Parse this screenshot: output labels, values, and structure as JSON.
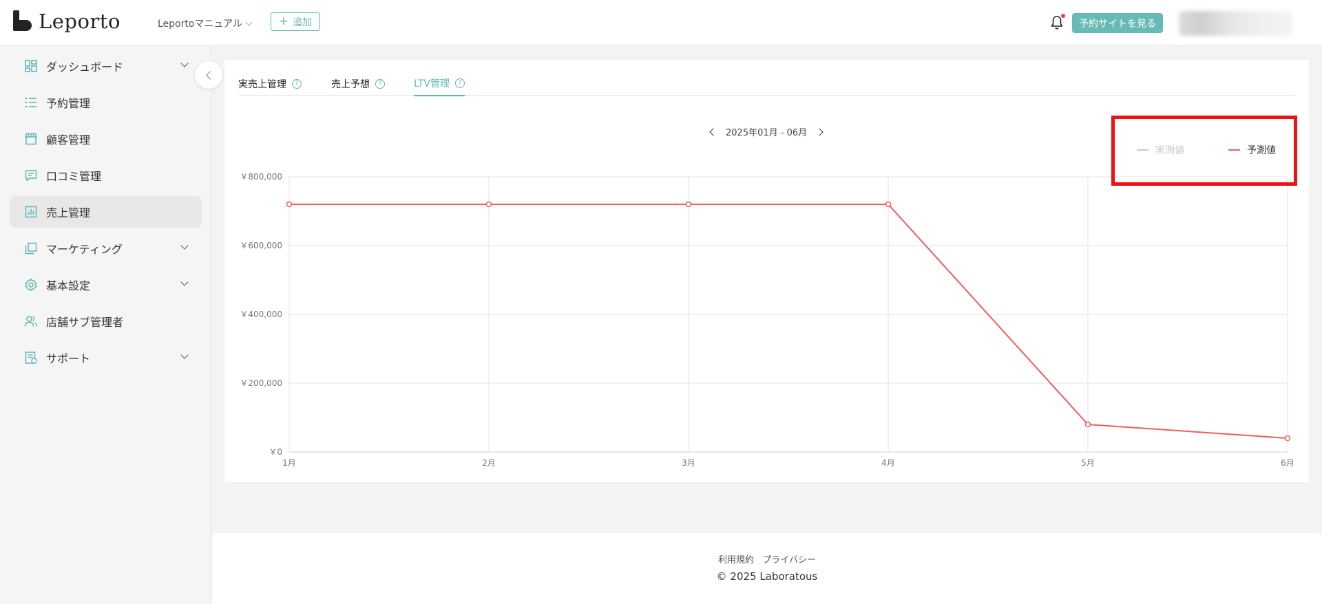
{
  "header": {
    "logo_text": "Leporto",
    "shop_name": "Leportoマニュアル",
    "add_label": "追加",
    "view_site_label": "予約サイトを見る"
  },
  "sidebar": {
    "items": [
      {
        "label": "ダッシュボード",
        "icon": "dashboard-icon",
        "expandable": true
      },
      {
        "label": "予約管理",
        "icon": "list-icon",
        "expandable": false
      },
      {
        "label": "顧客管理",
        "icon": "store-icon",
        "expandable": false
      },
      {
        "label": "口コミ管理",
        "icon": "comment-icon",
        "expandable": false
      },
      {
        "label": "売上管理",
        "icon": "bar-chart-icon",
        "expandable": false,
        "active": true
      },
      {
        "label": "マーケティング",
        "icon": "layers-icon",
        "expandable": true
      },
      {
        "label": "基本設定",
        "icon": "gear-icon",
        "expandable": true
      },
      {
        "label": "店舗サブ管理者",
        "icon": "users-icon",
        "expandable": false
      },
      {
        "label": "サポート",
        "icon": "document-icon",
        "expandable": true
      }
    ]
  },
  "tabs": [
    {
      "label": "実売上管理",
      "active": false
    },
    {
      "label": "売上予想",
      "active": false
    },
    {
      "label": "LTV管理",
      "active": true
    }
  ],
  "period_label": "2025年01月 - 06月",
  "legend": [
    {
      "label": "実測値",
      "color": "#cccccc",
      "enabled": false
    },
    {
      "label": "予測値",
      "color": "#f15c5c",
      "enabled": true
    }
  ],
  "chart_data": {
    "type": "line",
    "categories": [
      "1月",
      "2月",
      "3月",
      "4月",
      "5月",
      "6月"
    ],
    "series": [
      {
        "name": "予測値",
        "values": [
          720000,
          720000,
          720000,
          720000,
          80000,
          40000
        ],
        "color": "#f15c5c"
      }
    ],
    "ylim": [
      0,
      800000
    ],
    "yticks": [
      0,
      200000,
      400000,
      600000,
      800000
    ],
    "ytick_labels": [
      "￥0",
      "￥200,000",
      "￥400,000",
      "￥600,000",
      "￥800,000"
    ],
    "grid": true,
    "legend_position": "top-right"
  },
  "footer": {
    "links": [
      "利用規約",
      "プライバシー"
    ],
    "copyright": "© 2025 Laboratous"
  }
}
